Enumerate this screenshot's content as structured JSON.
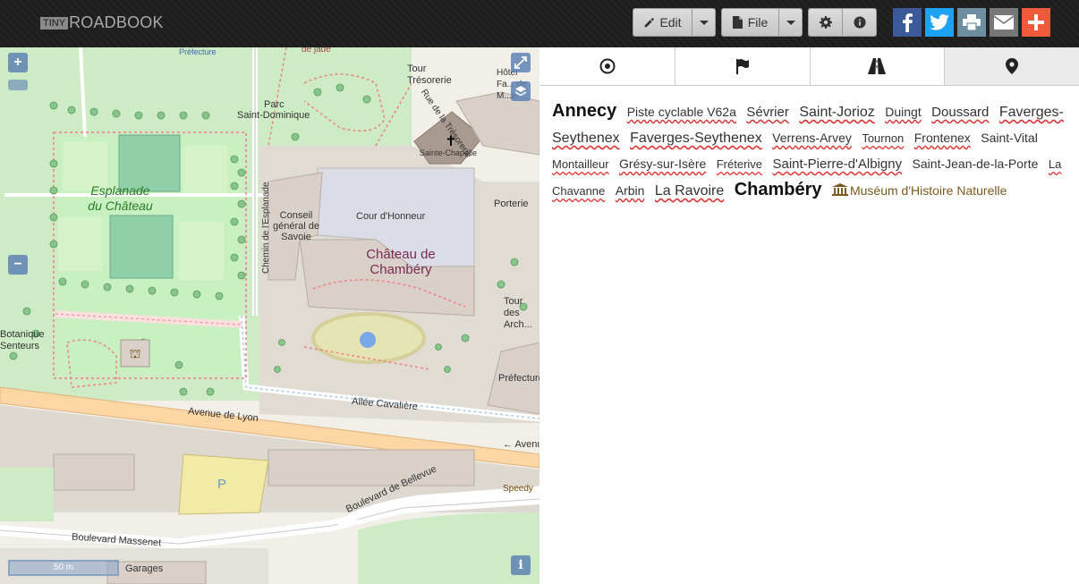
{
  "app": {
    "logo_tiny": "TINY",
    "logo_main": "ROADBOOK"
  },
  "toolbar": {
    "edit_label": "Edit",
    "file_label": "File",
    "settings_icon": "gear-icon",
    "info_icon": "info-icon"
  },
  "share": {
    "facebook_color": "#3b5998",
    "twitter_color": "#1da1f2",
    "print_color": "#6d8fa0",
    "email_color": "#777777",
    "more_color": "#f05a3a"
  },
  "map": {
    "labels": {
      "prefecture_top": "Préfecture",
      "de_jade": "de jade",
      "tour_tresorerie": "Tour Trésorerie",
      "rue_tresorerie": "Rue de la Trésorerie",
      "hotel": "Hôtel Fa... de M...x",
      "parc": "Parc",
      "saint_dominique": "Saint-Dominique",
      "sainte_chapelle": "Sainte-Chapelle",
      "esplanade": "Esplanade du Château",
      "chemin_esplanade": "Chemin de l'Esplanade",
      "conseil": "Conseil général de Savoie",
      "cour_honneur": "Cour d'Honneur",
      "chateau": "Château de Chambéry",
      "porterie": "Porterie",
      "tour_archives": "Tour des Arch...",
      "botanique": "Botanique Senteurs",
      "prefecture_right": "Préfecture",
      "allee_cavaliere": "Allée Cavalière",
      "avenue_lyon": "Avenue de Lyon",
      "avenue_right": "← Avenu...",
      "speedy": "Speedy",
      "boulevard_bellevue": "Boulevard de Bellevue",
      "boulevard_massenet": "Boulevard Massenet",
      "garages": "Garages",
      "parking": "P"
    },
    "scale": "50 m"
  },
  "tabs": [
    {
      "name": "target-icon"
    },
    {
      "name": "flag-icon"
    },
    {
      "name": "road-icon"
    },
    {
      "name": "map-marker-icon"
    }
  ],
  "places": [
    {
      "text": "Annecy",
      "style": "s20n"
    },
    {
      "text": "Piste cyclable V62a",
      "style": "s14"
    },
    {
      "text": "Sévrier",
      "style": "s15"
    },
    {
      "text": "Saint-Jorioz",
      "style": "s16"
    },
    {
      "text": "Duingt",
      "style": "s14"
    },
    {
      "text": "Doussard",
      "style": "s15"
    },
    {
      "text": "Faverges-Seythenex",
      "style": "s16"
    },
    {
      "text": "Faverges-Seythenex",
      "style": "s16"
    },
    {
      "text": "Verrens-Arvey",
      "style": "s14"
    },
    {
      "text": "Tournon",
      "style": "s13"
    },
    {
      "text": "Frontenex",
      "style": "s14"
    },
    {
      "text": "Saint-Vital",
      "style": "s14"
    },
    {
      "text": "Montailleur",
      "style": "s13"
    },
    {
      "text": "Grésy-sur-Isère",
      "style": "s14"
    },
    {
      "text": "Fréterive",
      "style": "s13"
    },
    {
      "text": "Saint-Pierre-d'Albigny",
      "style": "s15"
    },
    {
      "text": "Saint-Jean-de-la-Porte",
      "style": "s14"
    },
    {
      "text": "La Chavanne",
      "style": "s13"
    },
    {
      "text": "Arbin",
      "style": "s14"
    },
    {
      "text": "La Ravoire",
      "style": "s16"
    },
    {
      "text": "Chambéry",
      "style": "s20"
    },
    {
      "text": "Muséum d'Histoire Naturelle",
      "style": "museum"
    }
  ]
}
